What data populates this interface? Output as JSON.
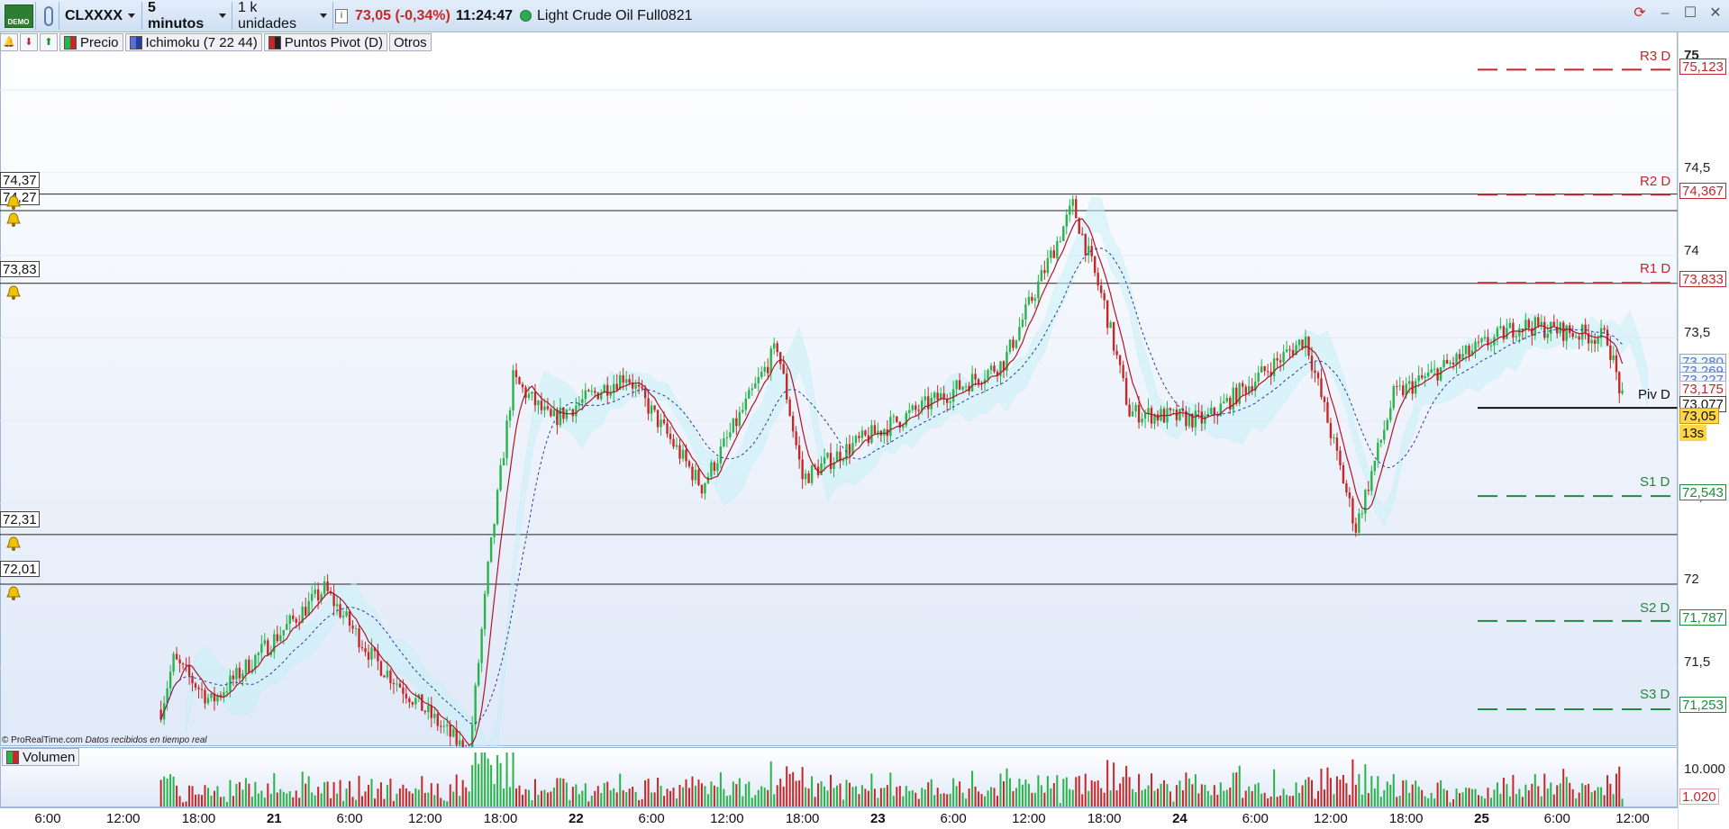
{
  "titlebar": {
    "demo_label": "DEMO",
    "symbol": "CLXXXX",
    "timeframe": "5 minutos",
    "units": "1 k unidades",
    "price_change": "73,05 (-0,34%)",
    "time": "11:24:47",
    "instrument": "Light Crude Oil Full0821",
    "info_icon": "info-icon",
    "window_controls": [
      "sync-icon",
      "minimize-icon",
      "maximize-icon",
      "close-icon"
    ]
  },
  "toolbar": {
    "items": [
      "Precio",
      "Ichimoku (7 22 44)",
      "Puntos Pivot (D)",
      "Otros"
    ]
  },
  "alarms": [
    "74,37",
    "74,27",
    "73,83",
    "72,31",
    "72,01"
  ],
  "pivots": {
    "R3": {
      "name": "R3 D",
      "value": "75,123"
    },
    "R2": {
      "name": "R2 D",
      "value": "74,367"
    },
    "R1": {
      "name": "R1 D",
      "value": "73,833"
    },
    "P": {
      "name": "Piv D",
      "value": "73,077"
    },
    "S1": {
      "name": "S1 D",
      "value": "72,543"
    },
    "S2": {
      "name": "S2 D",
      "value": "71,787"
    },
    "S3": {
      "name": "S3 D",
      "value": "71,253"
    }
  },
  "yaxis": {
    "ticks": [
      "75",
      "74,5",
      "74",
      "73,5",
      "73",
      "72,5",
      "72",
      "71,5"
    ],
    "overlay_tags": [
      "73,280",
      "73,269",
      "73,227",
      "73,175"
    ],
    "last_price": "73,05",
    "countdown": "13s"
  },
  "xaxis": {
    "labels": [
      "6:00",
      "12:00",
      "18:00",
      "21",
      "6:00",
      "12:00",
      "18:00",
      "22",
      "6:00",
      "12:00",
      "18:00",
      "23",
      "6:00",
      "12:00",
      "18:00",
      "24",
      "6:00",
      "12:00",
      "18:00",
      "25",
      "6:00",
      "12:00"
    ]
  },
  "volume": {
    "label": "Volumen",
    "ticks": [
      "10.000"
    ],
    "last_value": "1.020"
  },
  "watermark": {
    "source": "© ProRealTime.com",
    "note": "Datos recibidos en tiempo real"
  },
  "colors": {
    "up": "#29b34a",
    "down": "#c62828",
    "resistance": "#c0262f",
    "support": "#1f8a3a",
    "cloud_bull": "#c9f2f8",
    "cloud_bear": "#f8d4d4"
  },
  "chart_data": {
    "type": "candlestick",
    "timeframe": "5 minutos",
    "x_range": [
      "20 6:00",
      "25 12:00"
    ],
    "y_range": [
      70.9,
      75.4
    ],
    "series": [
      {
        "name": "Precio",
        "key_points": [
          {
            "x": "20 15:00",
            "y": 71.25
          },
          {
            "x": "20 16:00",
            "y": 71.55
          },
          {
            "x": "20 19:00",
            "y": 71.3
          },
          {
            "x": "21 4:00",
            "y": 71.98
          },
          {
            "x": "21 8:00",
            "y": 71.55
          },
          {
            "x": "21 15:30",
            "y": 70.98
          },
          {
            "x": "21 17:00",
            "y": 72.1
          },
          {
            "x": "21 19:00",
            "y": 73.25
          },
          {
            "x": "21 22:00",
            "y": 73.0
          },
          {
            "x": "22 4:00",
            "y": 73.28
          },
          {
            "x": "22 10:00",
            "y": 72.6
          },
          {
            "x": "22 16:00",
            "y": 73.45
          },
          {
            "x": "22 18:00",
            "y": 72.65
          },
          {
            "x": "22 22:00",
            "y": 72.85
          },
          {
            "x": "23 10:00",
            "y": 73.35
          },
          {
            "x": "23 15:30",
            "y": 74.3
          },
          {
            "x": "23 18:00",
            "y": 73.7
          },
          {
            "x": "23 20:00",
            "y": 73.05
          },
          {
            "x": "24 2:00",
            "y": 73.0
          },
          {
            "x": "24 10:00",
            "y": 73.5
          },
          {
            "x": "24 14:00",
            "y": 72.35
          },
          {
            "x": "24 17:00",
            "y": 73.15
          },
          {
            "x": "25 3:00",
            "y": 73.58
          },
          {
            "x": "25 10:00",
            "y": 73.5
          },
          {
            "x": "25 11:25",
            "y": 73.05
          }
        ]
      }
    ],
    "pivot_levels": {
      "R3": 75.123,
      "R2": 74.367,
      "R1": 73.833,
      "P": 73.077,
      "S1": 72.543,
      "S2": 71.787,
      "S3": 71.253
    },
    "alarm_levels": [
      74.37,
      74.27,
      73.83,
      72.31,
      72.01
    ]
  }
}
